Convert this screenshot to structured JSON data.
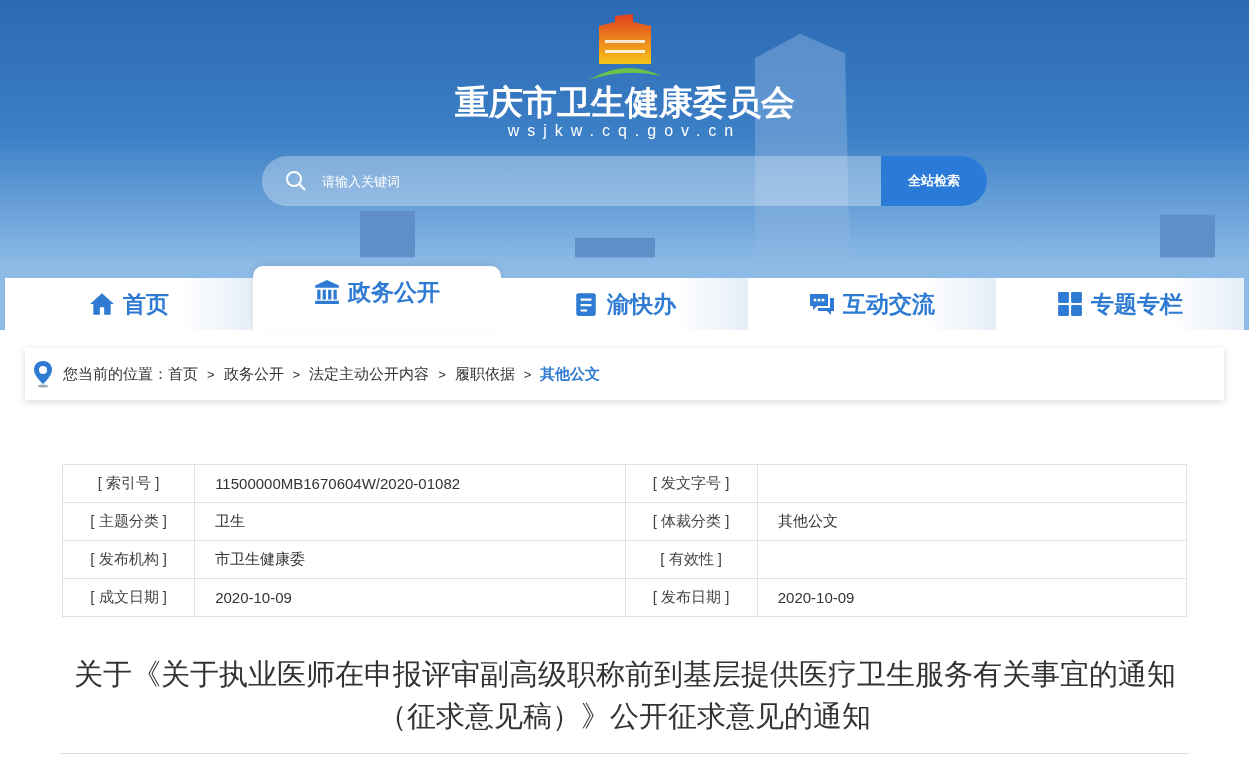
{
  "site": {
    "title": "重庆市卫生健康委员会",
    "domain": "wsjkw.cq.gov.cn"
  },
  "search": {
    "placeholder": "请输入关键词",
    "button": "全站检索"
  },
  "tabs": [
    {
      "label": "首页",
      "kind": "home",
      "selected": false
    },
    {
      "label": "政务公开",
      "kind": "bank",
      "selected": true
    },
    {
      "label": "渝快办",
      "kind": "clipboard",
      "selected": false
    },
    {
      "label": "互动交流",
      "kind": "chat",
      "selected": false
    },
    {
      "label": "专题专栏",
      "kind": "grid",
      "selected": false
    }
  ],
  "breadcrumb": {
    "prefix": "您当前的位置：",
    "separators": [
      ">",
      ">",
      ">",
      ">"
    ],
    "items": [
      {
        "label": "首页",
        "selected": false
      },
      {
        "label": "政务公开",
        "selected": false
      },
      {
        "label": "法定主动公开内容",
        "selected": false
      },
      {
        "label": "履职依据",
        "selected": false
      },
      {
        "label": "其他公文",
        "selected": true
      }
    ]
  },
  "info_table": {
    "rows": [
      [
        "[ 索引号 ]",
        "11500000MB1670604W/2020-01082",
        "[ 发文字号 ]",
        ""
      ],
      [
        "[ 主题分类 ]",
        "卫生",
        "[ 体裁分类 ]",
        "其他公文"
      ],
      [
        "[ 发布机构 ]",
        "市卫生健康委",
        "[ 有效性 ]",
        ""
      ],
      [
        "[ 成文日期 ]",
        "2020-10-09",
        "[ 发布日期 ]",
        "2020-10-09"
      ]
    ]
  },
  "article": {
    "title": "关于《关于执业医师在申报评审副高级职称前到基层提供医疗卫生服务有关事宜的通知（征求意见稿）》公开征求意见的通知"
  }
}
